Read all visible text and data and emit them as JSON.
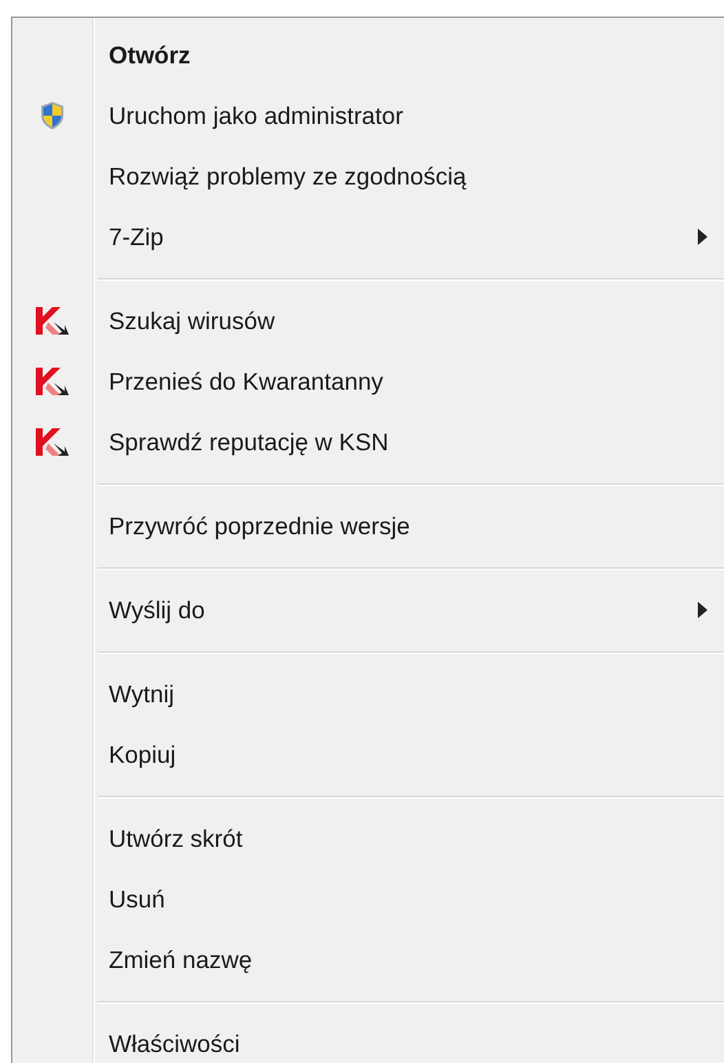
{
  "menu": {
    "items": [
      {
        "kind": "command",
        "label": "Otwórz",
        "default": true,
        "submenu": false
      },
      {
        "kind": "elevated",
        "label": "Uruchom jako administrator",
        "default": false,
        "submenu": false
      },
      {
        "kind": "command",
        "label": "Rozwiąż problemy ze zgodnością",
        "default": false,
        "submenu": false
      },
      {
        "kind": "command",
        "label": "7-Zip",
        "default": false,
        "submenu": true
      },
      {
        "kind": "separator"
      },
      {
        "kind": "antivirus",
        "label": "Szukaj wirusów",
        "default": false,
        "submenu": false
      },
      {
        "kind": "antivirus",
        "label": "Przenieś do Kwarantanny",
        "default": false,
        "submenu": false
      },
      {
        "kind": "antivirus",
        "label": "Sprawdź reputację w KSN",
        "default": false,
        "submenu": false
      },
      {
        "kind": "separator"
      },
      {
        "kind": "command",
        "label": "Przywróć poprzednie wersje",
        "default": false,
        "submenu": false
      },
      {
        "kind": "separator"
      },
      {
        "kind": "command",
        "label": "Wyślij do",
        "default": false,
        "submenu": true
      },
      {
        "kind": "separator"
      },
      {
        "kind": "command",
        "label": "Wytnij",
        "default": false,
        "submenu": false
      },
      {
        "kind": "command",
        "label": "Kopiuj",
        "default": false,
        "submenu": false
      },
      {
        "kind": "separator"
      },
      {
        "kind": "command",
        "label": "Utwórz skrót",
        "default": false,
        "submenu": false
      },
      {
        "kind": "command",
        "label": "Usuń",
        "default": false,
        "submenu": false
      },
      {
        "kind": "command",
        "label": "Zmień nazwę",
        "default": false,
        "submenu": false
      },
      {
        "kind": "separator"
      },
      {
        "kind": "command",
        "label": "Właściwości",
        "default": false,
        "submenu": false
      }
    ]
  }
}
